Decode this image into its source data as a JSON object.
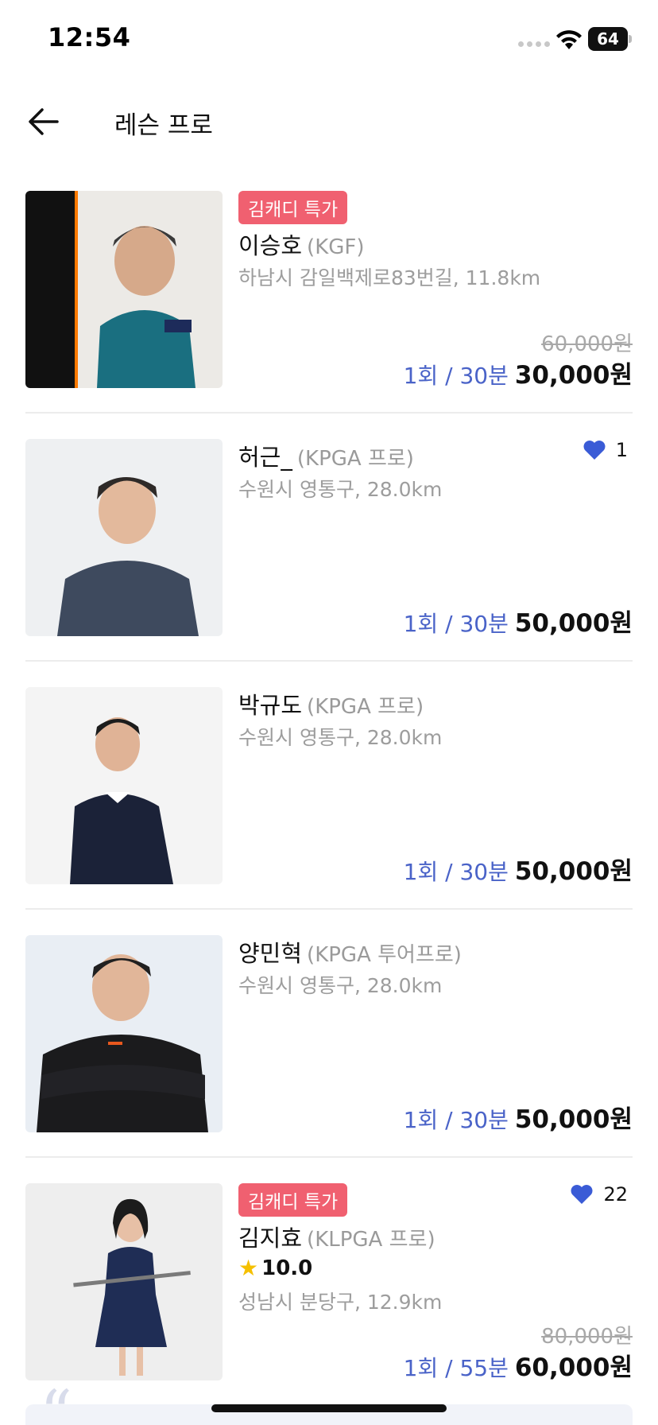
{
  "status_bar": {
    "time": "12:54",
    "battery": "64"
  },
  "header": {
    "title": "레슨 프로"
  },
  "pros": [
    {
      "badge": "김캐디 특가",
      "name": "이승호",
      "cert": "(KGF)",
      "location": "하남시 감일백제로83번길, 11.8km",
      "original_price": "60,000원",
      "unit": "1회 / 30분",
      "price": "30,000원"
    },
    {
      "name": "허근_",
      "cert": "(KPGA 프로)",
      "location": "수원시 영통구, 28.0km",
      "likes": "1",
      "unit": "1회 / 30분",
      "price": "50,000원"
    },
    {
      "name": "박규도",
      "cert": "(KPGA 프로)",
      "location": "수원시 영통구, 28.0km",
      "unit": "1회 / 30분",
      "price": "50,000원"
    },
    {
      "name": "양민혁",
      "cert": "(KPGA 투어프로)",
      "location": "수원시 영통구, 28.0km",
      "unit": "1회 / 30분",
      "price": "50,000원"
    },
    {
      "badge": "김캐디 특가",
      "name": "김지효",
      "cert": "(KLPGA 프로)",
      "rating": "10.0",
      "location": "성남시 분당구, 12.9km",
      "likes": "22",
      "original_price": "80,000원",
      "unit": "1회 / 55분",
      "price": "60,000원"
    }
  ],
  "colors": {
    "badge": "#f06070",
    "price_unit": "#4a63c8",
    "heart": "#3a5bd6"
  }
}
